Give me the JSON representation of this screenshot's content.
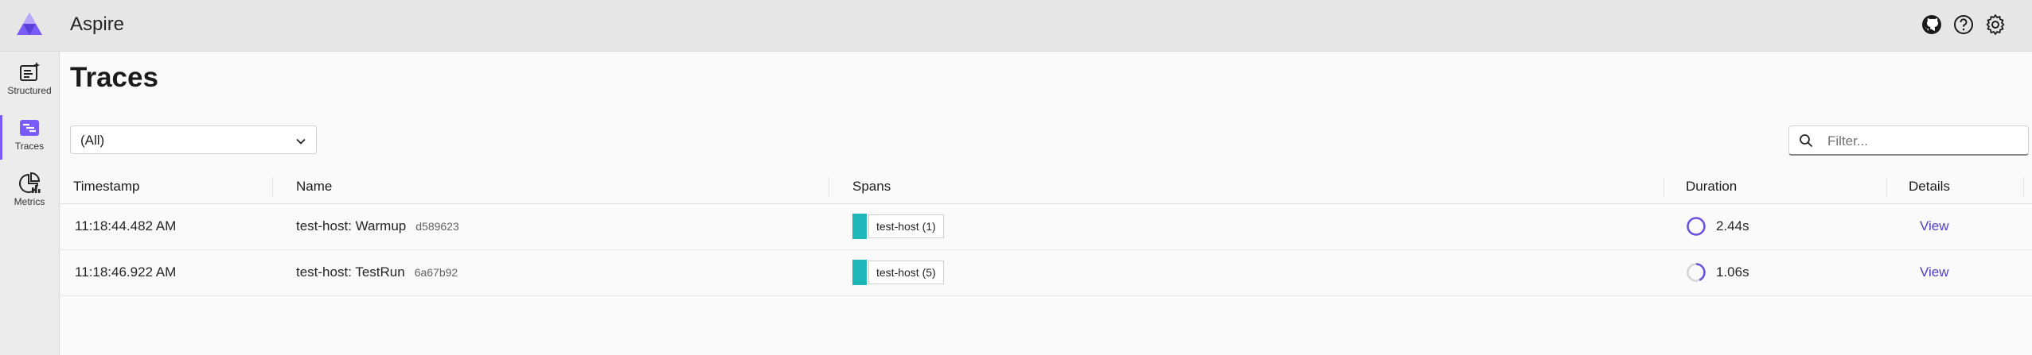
{
  "header": {
    "app_title": "Aspire",
    "icons": [
      "github-icon",
      "help-icon",
      "settings-icon"
    ]
  },
  "sidebar": {
    "items": [
      {
        "label": "Structured",
        "icon": "structured-logs-icon",
        "active": false
      },
      {
        "label": "Traces",
        "icon": "traces-icon",
        "active": true
      },
      {
        "label": "Metrics",
        "icon": "metrics-icon",
        "active": false
      }
    ]
  },
  "main": {
    "title": "Traces",
    "resource_select": {
      "value": "(All)"
    },
    "filter": {
      "placeholder": "Filter..."
    }
  },
  "table": {
    "columns": [
      "Timestamp",
      "Name",
      "Spans",
      "Duration",
      "Details"
    ],
    "rows": [
      {
        "timestamp": "11:18:44.482 AM",
        "name": "test-host: Warmup",
        "trace_id": "d589623",
        "span_label": "test-host (1)",
        "duration": "2.44s",
        "duration_fraction": 1.0,
        "details": "View"
      },
      {
        "timestamp": "11:18:46.922 AM",
        "name": "test-host: TestRun",
        "trace_id": "6a67b92",
        "span_label": "test-host (5)",
        "duration": "1.06s",
        "duration_fraction": 0.43,
        "details": "View"
      }
    ]
  },
  "colors": {
    "accent": "#7a5af8",
    "span_bar": "#1db7b9",
    "link": "#4f3fc4"
  }
}
